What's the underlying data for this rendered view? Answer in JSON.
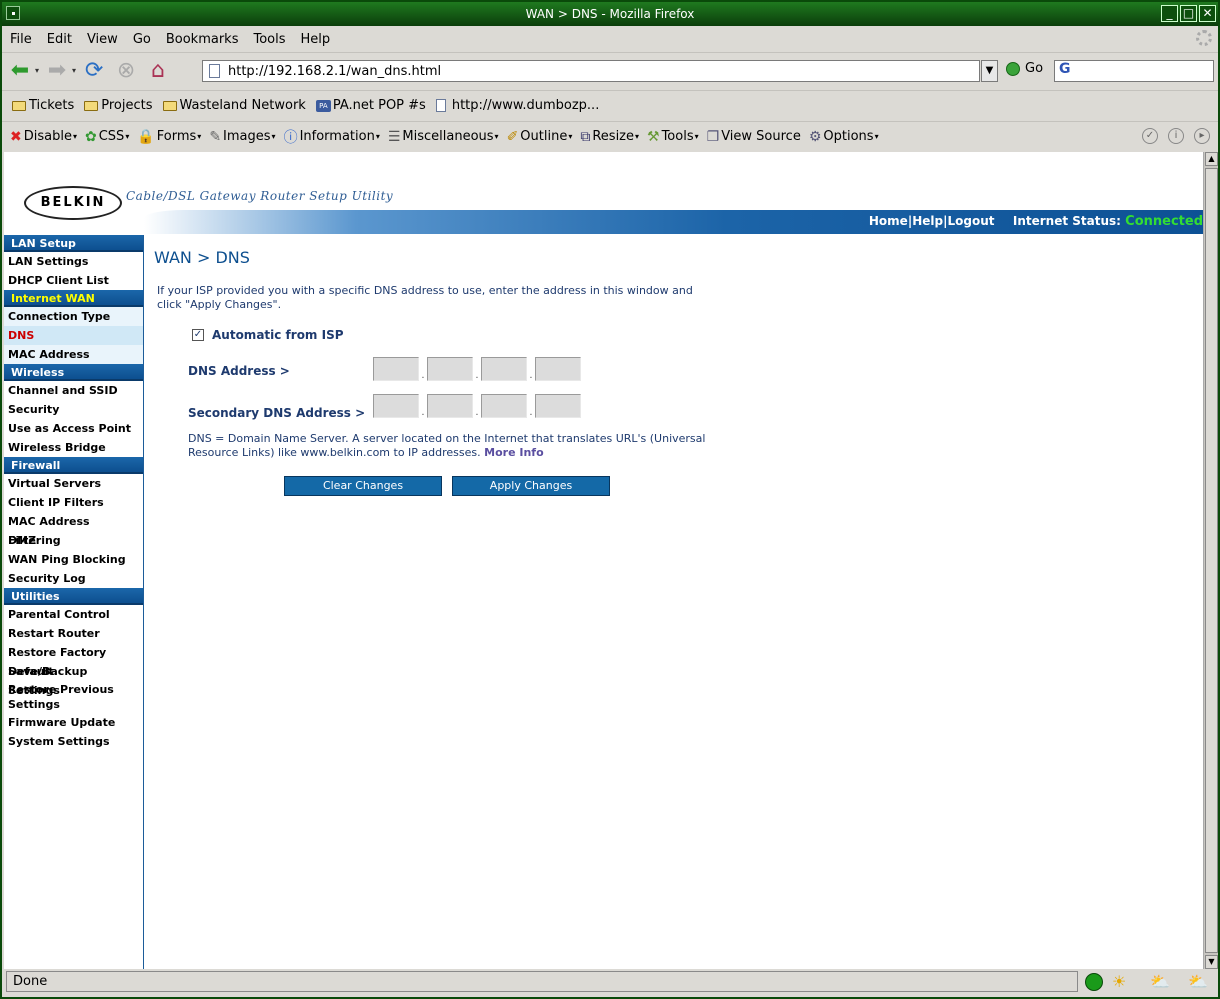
{
  "window": {
    "title": "WAN > DNS - Mozilla Firefox"
  },
  "menu": [
    "File",
    "Edit",
    "View",
    "Go",
    "Bookmarks",
    "Tools",
    "Help"
  ],
  "nav": {
    "url": "http://192.168.2.1/wan_dns.html",
    "go_label": "Go",
    "search_value": "G"
  },
  "bookmarks": [
    "Tickets",
    "Projects",
    "Wasteland Network",
    "PA.net POP #s",
    "http://www.dumbozp..."
  ],
  "bookmark_icons": {
    "pa": "PA"
  },
  "devtoolbar": [
    "Disable",
    "CSS",
    "Forms",
    "Images",
    "Information",
    "Miscellaneous",
    "Outline",
    "Resize",
    "Tools",
    "View Source",
    "Options"
  ],
  "header": {
    "logo": "BELKIN",
    "tagline": "Cable/DSL Gateway Router Setup Utility",
    "links": [
      "Home",
      "Help",
      "Logout"
    ],
    "status_label": "Internet Status:",
    "status_value": "Connected",
    "status_color": "#33dd33"
  },
  "sidebar": {
    "lan": {
      "title": "LAN Setup",
      "items": [
        "LAN Settings",
        "DHCP Client List"
      ]
    },
    "wan": {
      "title": "Internet WAN",
      "items": [
        "Connection Type",
        "DNS",
        "MAC Address"
      ]
    },
    "wireless": {
      "title": "Wireless",
      "items": [
        "Channel and SSID",
        "Security",
        "Use as Access Point",
        "Wireless Bridge"
      ]
    },
    "firewall": {
      "title": "Firewall",
      "items": [
        "Virtual Servers",
        "Client IP Filters",
        "MAC Address Filtering",
        "DMZ",
        "WAN Ping Blocking",
        "Security Log"
      ]
    },
    "utilities": {
      "title": "Utilities",
      "items": [
        "Parental Control",
        "Restart Router",
        "Restore Factory Default",
        "Save/Backup Settings",
        "Restore Previous Settings",
        "Firmware Update",
        "System Settings"
      ]
    }
  },
  "main": {
    "title": "WAN > DNS",
    "intro": "If your ISP provided you with a specific DNS address to use, enter the address in this window and click \"Apply Changes\".",
    "auto_label": "Automatic from ISP",
    "auto_checked": true,
    "dns_label": "DNS Address >",
    "dns2_label": "Secondary DNS Address >",
    "dns_values": [
      "",
      "",
      "",
      ""
    ],
    "dns2_values": [
      "",
      "",
      "",
      ""
    ],
    "note": "DNS = Domain Name Server. A server located on the Internet that translates URL's (Universal Resource Links) like www.belkin.com to IP addresses.",
    "more_info": "More Info",
    "clear_label": "Clear Changes",
    "apply_label": "Apply Changes"
  },
  "status": {
    "text": "Done"
  }
}
